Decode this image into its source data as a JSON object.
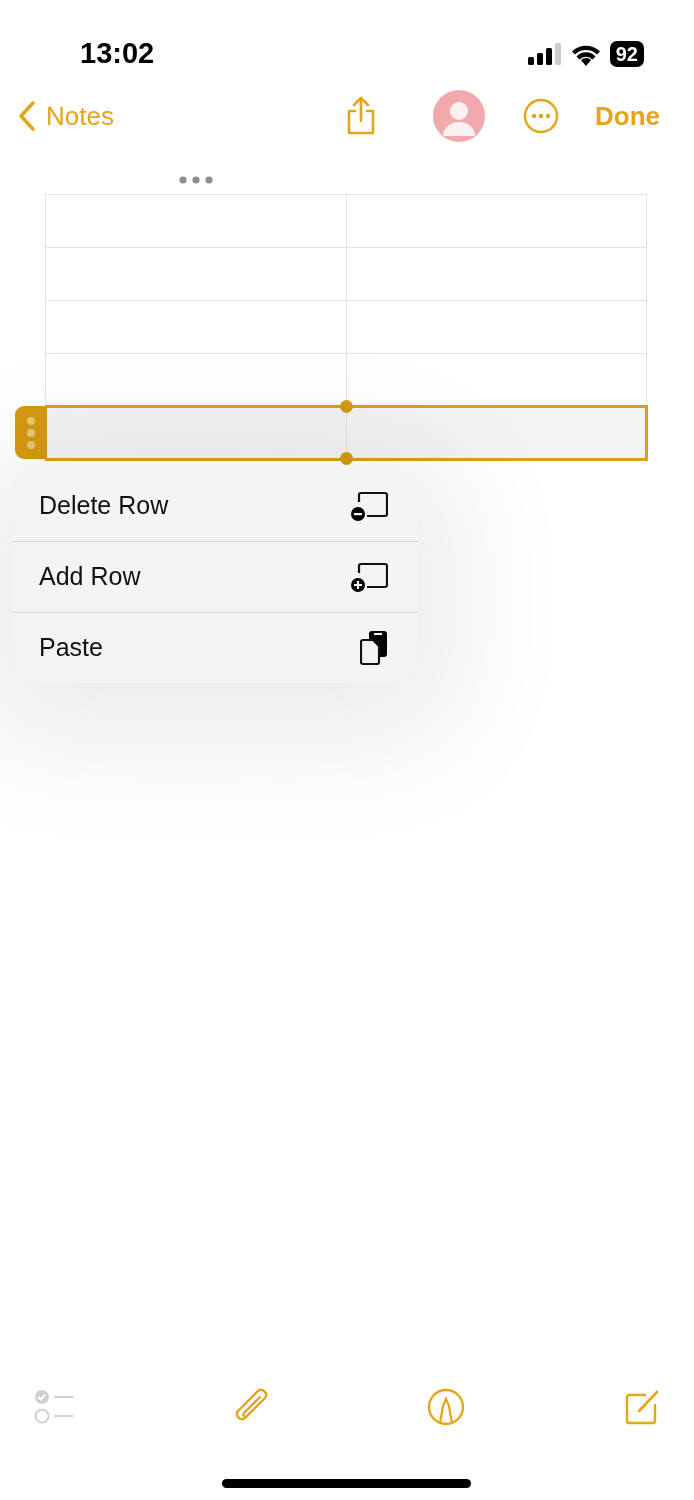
{
  "status_bar": {
    "time": "13:02",
    "battery": "92"
  },
  "nav": {
    "back": "Notes",
    "done": "Done"
  },
  "table": {
    "rows": [
      {
        "selected": false
      },
      {
        "selected": false
      },
      {
        "selected": false
      },
      {
        "selected": false
      },
      {
        "selected": true
      }
    ]
  },
  "menu": [
    {
      "label": "Delete Row",
      "kind": "delete-row"
    },
    {
      "label": "Add Row",
      "kind": "add-row"
    },
    {
      "label": "Paste",
      "kind": "paste"
    }
  ],
  "toolbar": [
    {
      "kind": "checklist",
      "disabled": true
    },
    {
      "kind": "attach",
      "disabled": false
    },
    {
      "kind": "markup",
      "disabled": false
    },
    {
      "kind": "compose",
      "disabled": false
    }
  ]
}
